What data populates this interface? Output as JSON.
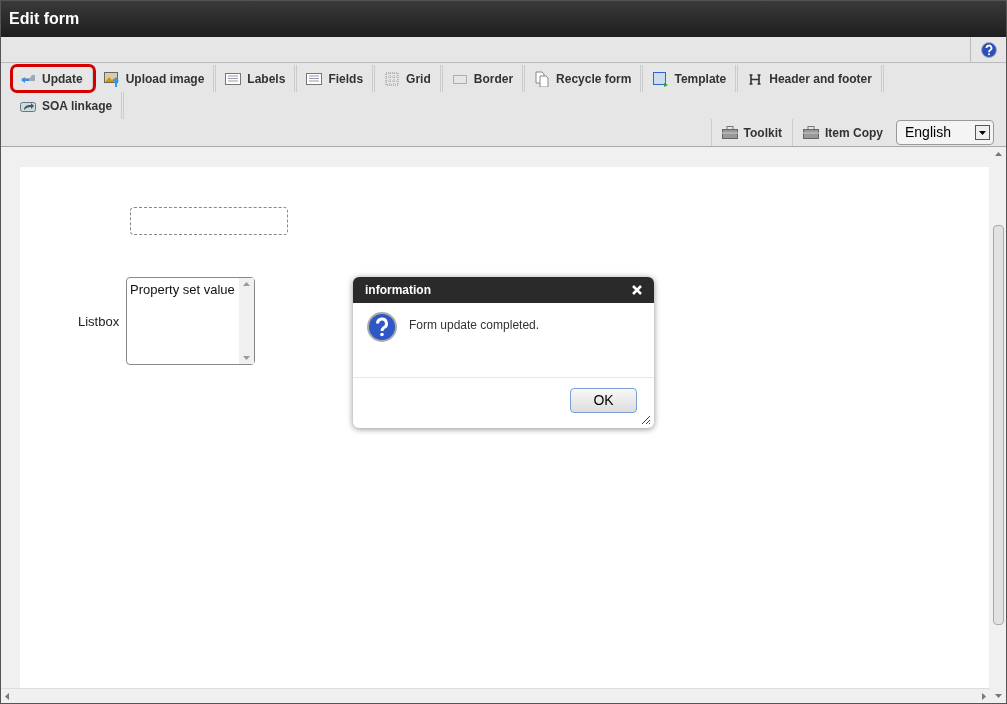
{
  "window": {
    "title": "Edit form"
  },
  "toolbar": {
    "items": [
      {
        "label": "Update",
        "kind": "update",
        "highlighted": true
      },
      {
        "label": "Upload image",
        "kind": "upload",
        "highlighted": false
      },
      {
        "label": "Labels",
        "kind": "list",
        "highlighted": false
      },
      {
        "label": "Fields",
        "kind": "list",
        "highlighted": false
      },
      {
        "label": "Grid",
        "kind": "grid",
        "highlighted": false
      },
      {
        "label": "Border",
        "kind": "border",
        "highlighted": false
      },
      {
        "label": "Recycle form",
        "kind": "copy",
        "highlighted": false
      },
      {
        "label": "Template",
        "kind": "template",
        "highlighted": false
      },
      {
        "label": "Header and footer",
        "kind": "header",
        "highlighted": false
      },
      {
        "label": "SOA linkage",
        "kind": "link",
        "highlighted": false
      }
    ],
    "right_items": [
      {
        "label": "Toolkit"
      },
      {
        "label": "Item Copy"
      }
    ],
    "language": {
      "value": "English"
    }
  },
  "canvas": {
    "listbox": {
      "label": "Listbox",
      "value": "Property set value"
    }
  },
  "dialog": {
    "title": "information",
    "message": "Form update completed.",
    "button": "OK"
  }
}
